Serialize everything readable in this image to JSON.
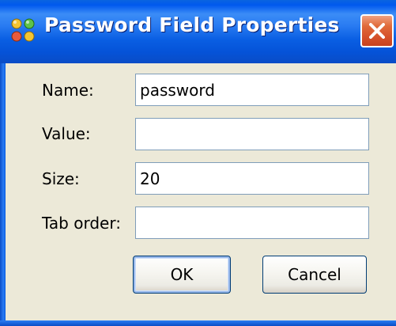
{
  "window": {
    "title": "Password Field Properties",
    "app_icon": "dots-grid-icon",
    "close_icon": "close-icon"
  },
  "form": {
    "name_label": "Name:",
    "name_value": "password",
    "value_label": "Value:",
    "value_value": "",
    "size_label": "Size:",
    "size_value": "20",
    "tab_order_label": "Tab order:",
    "tab_order_value": ""
  },
  "buttons": {
    "ok_label": "OK",
    "cancel_label": "Cancel"
  },
  "colors": {
    "titlebar": "#0058ee",
    "dialog_bg": "#ece9d8",
    "close_button": "#d6512a",
    "field_border": "#7f9db9"
  }
}
